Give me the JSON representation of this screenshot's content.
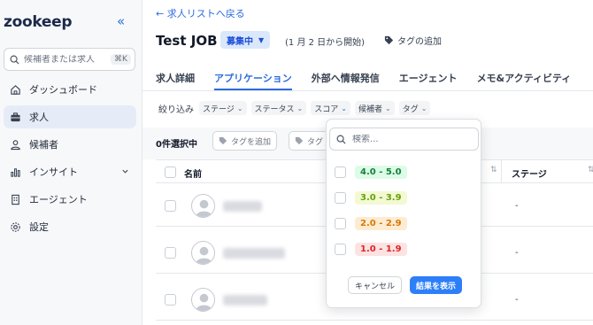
{
  "brand": {
    "logo_text": "zookeep",
    "accent": "#2d7ff9"
  },
  "sidebar": {
    "search_placeholder": "候補者または求人",
    "search_shortcut": "⌘K",
    "items": [
      {
        "label": "ダッシュボード",
        "icon": "home-icon"
      },
      {
        "label": "求人",
        "icon": "briefcase-icon",
        "active": true
      },
      {
        "label": "候補者",
        "icon": "users-icon"
      },
      {
        "label": "インサイト",
        "icon": "bar-chart-icon",
        "expandable": true
      },
      {
        "label": "エージェント",
        "icon": "building-icon"
      },
      {
        "label": "設定",
        "icon": "gear-icon"
      }
    ]
  },
  "header": {
    "back_link": "← 求人リストへ戻る",
    "job_title": "Test JOB",
    "status": "募集中",
    "date_note": "(1 月 2 日から開始)",
    "add_tag": "タグの追加"
  },
  "tabs": [
    {
      "label": "求人詳細"
    },
    {
      "label": "アプリケーション",
      "active": true
    },
    {
      "label": "外部へ情報発信"
    },
    {
      "label": "エージェント"
    },
    {
      "label": "メモ&アクティビティ"
    }
  ],
  "filters": {
    "label": "絞り込み",
    "chips": [
      "ステージ",
      "ステータス",
      "スコア",
      "候補者",
      "タグ"
    ]
  },
  "table": {
    "selected_count": "0件選択中",
    "add_tag_button": "タグを追加",
    "second_button": "タグ",
    "columns": {
      "name": "名前",
      "stage": "ステージ"
    },
    "rows": [
      {
        "stage": "-"
      },
      {
        "stage": "-"
      },
      {
        "stage": "-"
      }
    ]
  },
  "score_dropdown": {
    "search_placeholder": "検索...",
    "options": [
      {
        "label": "4.0 - 5.0",
        "fg": "#15803d",
        "bg": "#dcfce7"
      },
      {
        "label": "3.0 - 3.9",
        "fg": "#65a30d",
        "bg": "#f3f9d2"
      },
      {
        "label": "2.0 - 2.9",
        "fg": "#d97706",
        "bg": "#fdecd2"
      },
      {
        "label": "1.0 - 1.9",
        "fg": "#dc2626",
        "bg": "#fde2e2"
      }
    ],
    "cancel_label": "キャンセル",
    "apply_label": "結果を表示"
  }
}
